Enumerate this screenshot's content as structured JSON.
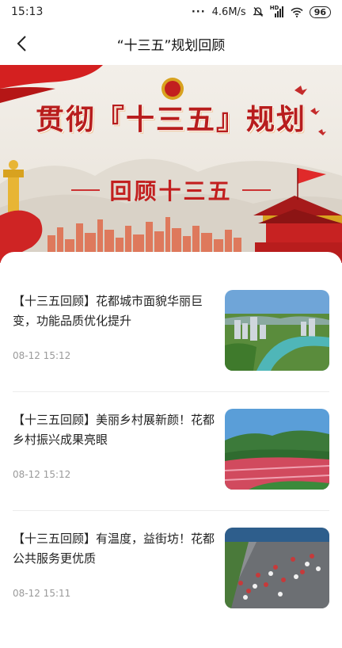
{
  "status_bar": {
    "time": "15:13",
    "dots": "···",
    "speed": "4.6M/s",
    "network": "HD",
    "battery": "96"
  },
  "nav": {
    "title": "“十三五”规划回顾"
  },
  "banner": {
    "title": "贯彻『十三五』规划",
    "subtitle": "回顾十三五"
  },
  "news": [
    {
      "title": "【十三五回顾】花都城市面貌华丽巨变，功能品质优化提升",
      "time": "08-12 15:12",
      "thumbnail": "city-river-aerial"
    },
    {
      "title": "【十三五回顾】美丽乡村展新颜！花都乡村振兴成果亮眼",
      "time": "08-12 15:12",
      "thumbnail": "flower-fields-village"
    },
    {
      "title": "【十三五回顾】有温度，益街坊！花都公共服务更优质",
      "time": "08-12 15:11",
      "thumbnail": "marathon-crowd"
    }
  ],
  "colors": {
    "banner_red": "#b81d1d",
    "time_gray": "#9a9a9a"
  }
}
